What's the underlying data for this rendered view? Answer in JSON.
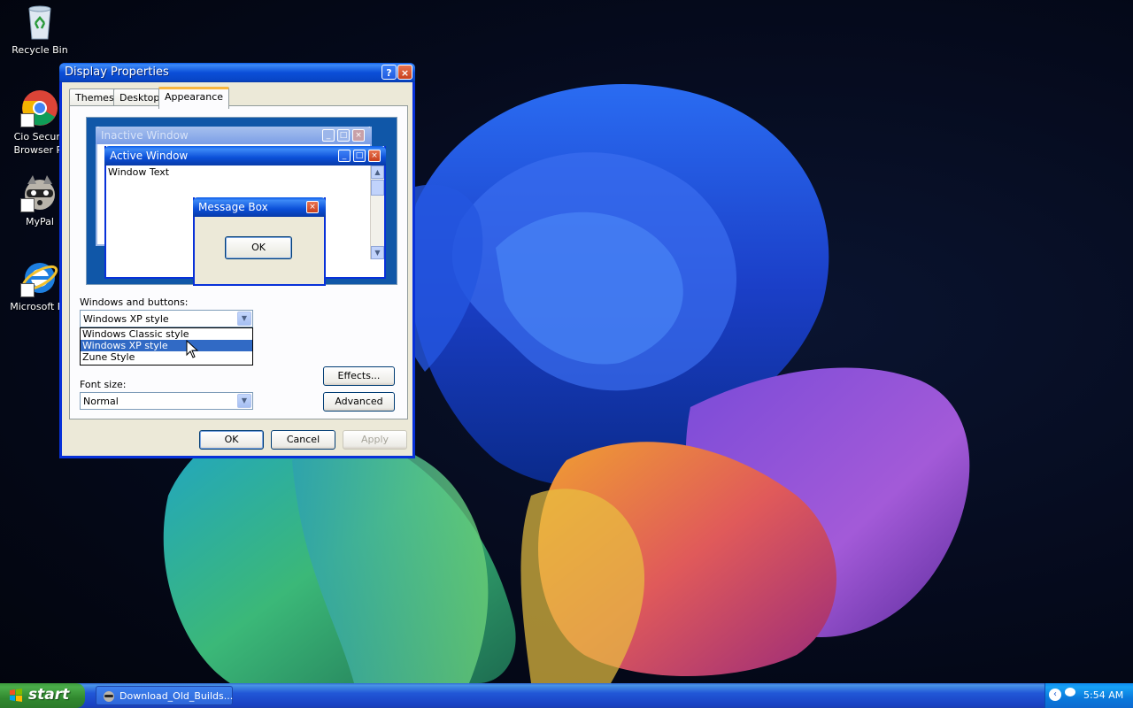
{
  "desktop": {
    "icons": [
      {
        "label": "Recycle Bin"
      },
      {
        "label": "Cio Secure Browser Pr"
      },
      {
        "label": "MyPal"
      },
      {
        "label": "Microsoft Ed"
      }
    ]
  },
  "dialog": {
    "title": "Display Properties",
    "help_btn": "?",
    "close_btn": "×",
    "tabs": [
      {
        "label": "Themes"
      },
      {
        "label": "Desktop"
      },
      {
        "label": "Appearance",
        "active": true
      }
    ],
    "preview": {
      "inactive_title": "Inactive Window",
      "active_title": "Active Window",
      "window_text": "Window Text",
      "msgbox_title": "Message Box",
      "msgbox_ok": "OK"
    },
    "windows_buttons_label": "Windows and buttons:",
    "windows_buttons_value": "Windows XP style",
    "dropdown_options": [
      "Windows Classic style",
      "Windows XP style",
      "Zune Style"
    ],
    "dropdown_selected": "Windows XP style",
    "font_size_label": "Font size:",
    "font_size_value": "Normal",
    "effects_btn": "Effects...",
    "advanced_btn": "Advanced",
    "ok_btn": "OK",
    "cancel_btn": "Cancel",
    "apply_btn": "Apply"
  },
  "taskbar": {
    "start_label": "start",
    "task_button": "Download_Old_Builds...",
    "clock": "5:54 AM"
  }
}
